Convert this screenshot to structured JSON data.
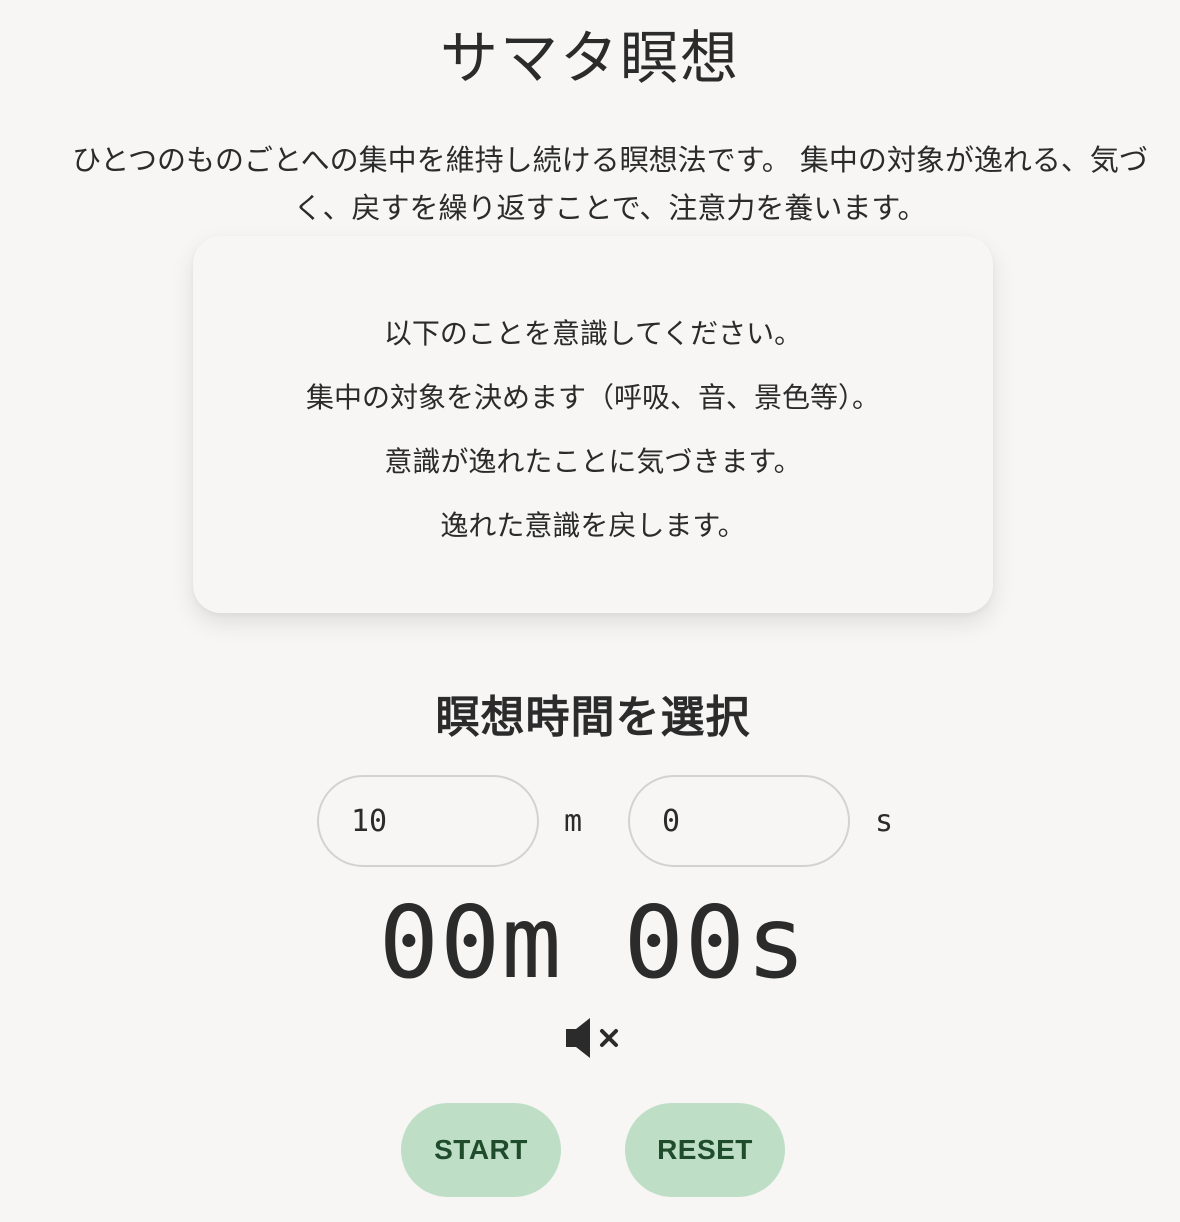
{
  "page": {
    "title": "サマタ瞑想",
    "description": "ひとつのものごとへの集中を維持し続ける瞑想法です。 集中の対象が逸れる、気づく、戻すを繰り返すことで、注意力を養います。"
  },
  "instructions": {
    "lines": [
      "以下のことを意識してください。",
      "集中の対象を決めます（呼吸、音、景色等）。",
      "意識が逸れたことに気づきます。",
      "逸れた意識を戻します。"
    ]
  },
  "duration": {
    "heading": "瞑想時間を選択",
    "minutes_value": "10",
    "minutes_unit": "m",
    "seconds_value": "0",
    "seconds_unit": "s"
  },
  "timer": {
    "display": "00m 00s"
  },
  "sound": {
    "icon": "speaker-muted-icon",
    "state": "muted"
  },
  "controls": {
    "start_label": "START",
    "reset_label": "RESET"
  },
  "colors": {
    "background": "#f7f6f5",
    "button_bg": "#bfdec6",
    "button_text": "#1f4d2c",
    "text": "#2b2b2b"
  }
}
